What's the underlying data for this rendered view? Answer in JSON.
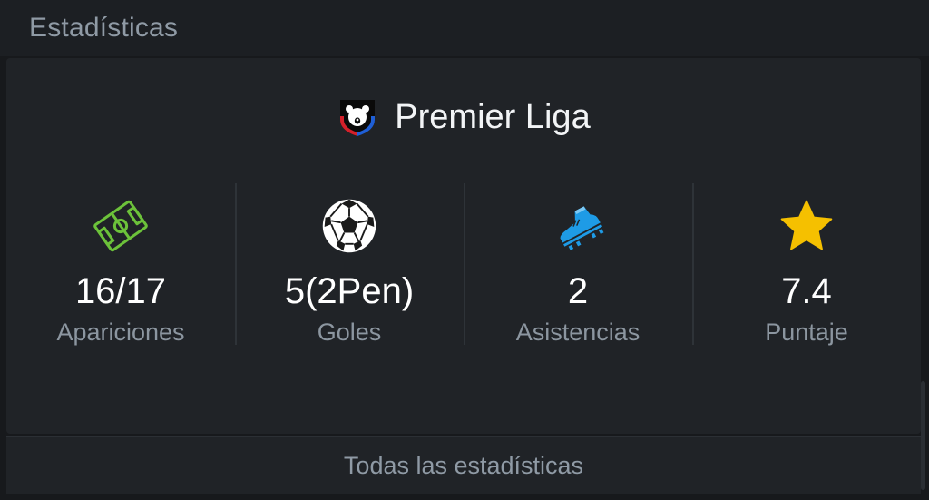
{
  "section": {
    "title": "Estadísticas"
  },
  "league": {
    "name": "Premier Liga",
    "logo_icon": "bear-shield-logo"
  },
  "stats": [
    {
      "value": "16/17",
      "label": "Apariciones",
      "icon": "pitch-icon",
      "color": "#6cc23a"
    },
    {
      "value": "5(2Pen)",
      "label": "Goles",
      "icon": "soccer-ball-icon",
      "color": "#ffffff"
    },
    {
      "value": "2",
      "label": "Asistencias",
      "icon": "boot-icon",
      "color": "#1e9be6"
    },
    {
      "value": "7.4",
      "label": "Puntaje",
      "icon": "star-icon",
      "color": "#f5c000"
    }
  ],
  "footer": {
    "label": "Todas las estadísticas"
  }
}
